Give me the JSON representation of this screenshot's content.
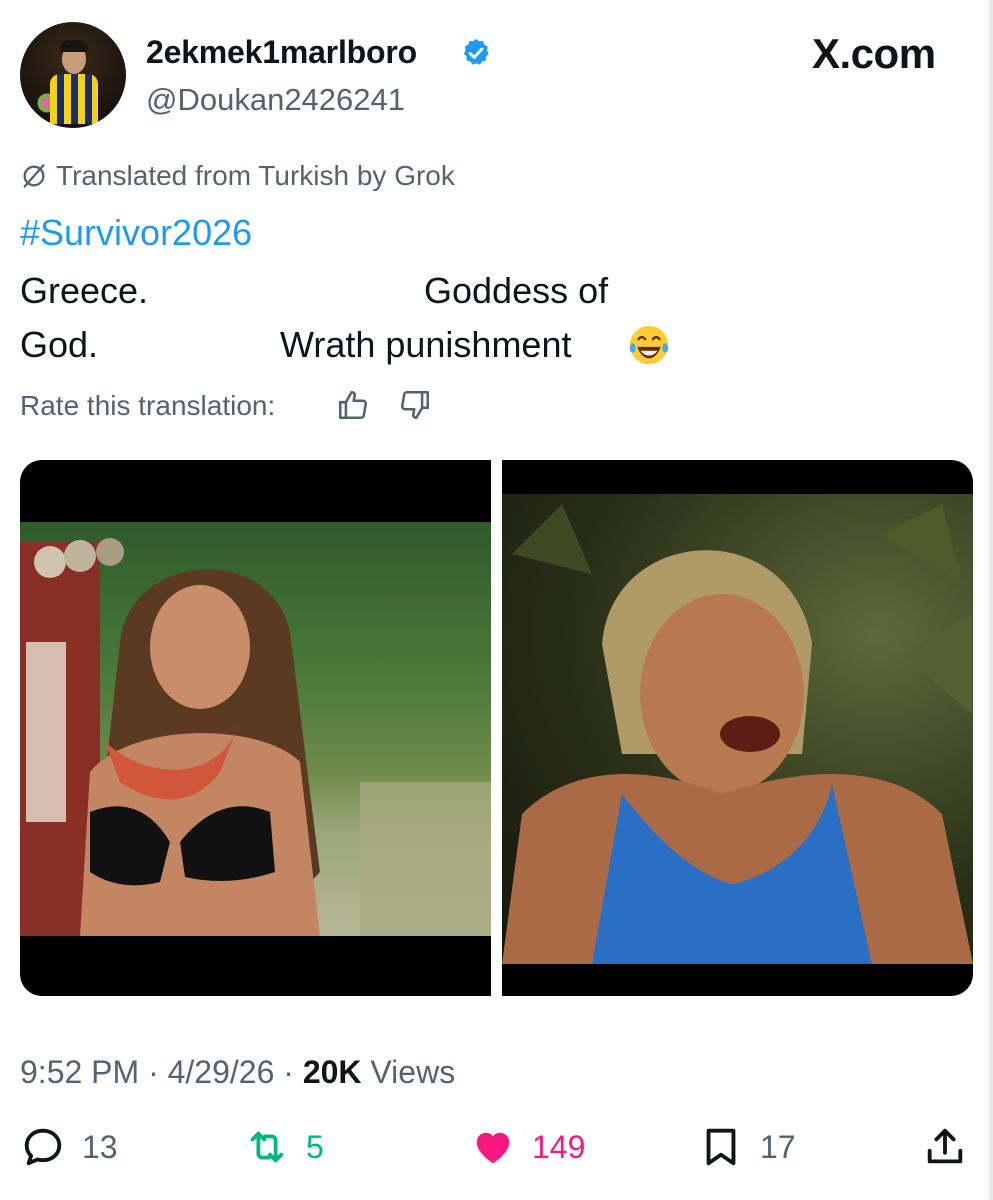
{
  "header": {
    "display_name": "2ekmek1marlboro",
    "handle": "@Doukan2426241",
    "site_logo": "X.com",
    "verified_color": "#1d9bf0"
  },
  "translation": {
    "notice": "Translated from Turkish by Grok",
    "rate_label": "Rate this translation:"
  },
  "post": {
    "hashtag": "#Survivor2026",
    "line1_left": "Greece.",
    "line1_right": "Goddess of",
    "line2_left": "God.",
    "line2_right": "Wrath punishment",
    "emoji": "face-with-tears-of-joy"
  },
  "meta": {
    "time": "9:52 PM",
    "sep1": "·",
    "date": "4/29/26",
    "sep2": "·",
    "views_count": "20K",
    "views_label": "Views"
  },
  "actions": {
    "replies": "13",
    "reposts": "5",
    "likes": "149",
    "bookmarks": "17",
    "repost_color": "#00ba7c",
    "like_color": "#f91880"
  },
  "icons": [
    "verified-badge-icon",
    "grok-icon",
    "thumbs-up-icon",
    "thumbs-down-icon",
    "reply-icon",
    "repost-icon",
    "heart-icon",
    "bookmark-icon",
    "share-icon"
  ]
}
